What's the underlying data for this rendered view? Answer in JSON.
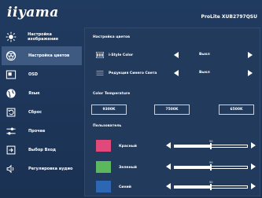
{
  "header": {
    "brand": "iiyama",
    "model": "ProLite XUB2797QSU"
  },
  "sidebar": {
    "items": [
      {
        "label": "Настройка изображения",
        "icon": "brightness-icon"
      },
      {
        "label": "Настройка цветов",
        "icon": "color-palette-icon",
        "active": true
      },
      {
        "label": "OSD",
        "icon": "osd-icon"
      },
      {
        "label": "Язык",
        "icon": "globe-icon"
      },
      {
        "label": "Сброс",
        "icon": "reset-icon"
      },
      {
        "label": "Прочее",
        "icon": "sliders-icon"
      },
      {
        "label": "Выбор Вход",
        "icon": "input-icon"
      },
      {
        "label": "Регулировка аудио",
        "icon": "speaker-icon"
      }
    ]
  },
  "panel": {
    "title": "Настройка цветов",
    "i_style": {
      "label": "i-Style Color",
      "value": "Выкл"
    },
    "blue_light": {
      "label": "Редукция Синего Света",
      "value": "Выкл"
    },
    "color_temp": {
      "title": "Color Temperature",
      "options": [
        "9300K",
        "7500K",
        "6500K"
      ]
    },
    "user": {
      "title": "Пользователь",
      "channels": [
        {
          "label": "Красный",
          "value": 50,
          "color": "#e0497a"
        },
        {
          "label": "Зеленый",
          "value": 50,
          "color": "#5cb85c"
        },
        {
          "label": "Синий",
          "value": 50,
          "color": "#2d67b3"
        }
      ]
    }
  }
}
